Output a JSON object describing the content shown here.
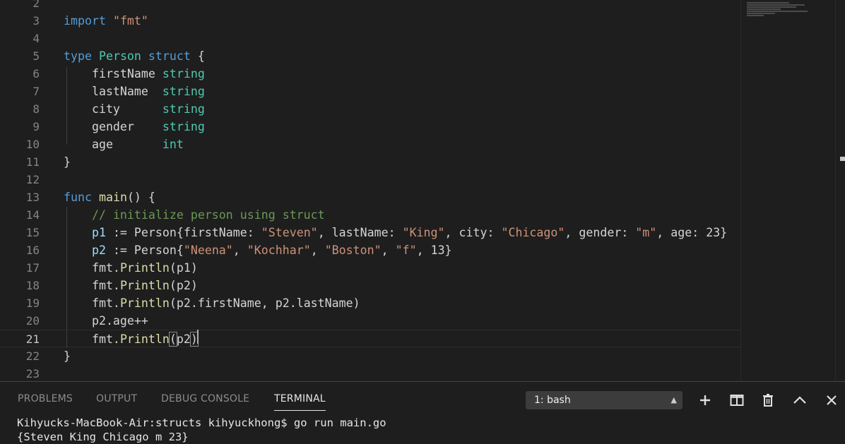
{
  "editor": {
    "lines": [
      {
        "num": "2",
        "tokens": []
      },
      {
        "num": "3",
        "tokens": [
          [
            "kw",
            "import"
          ],
          [
            "plain",
            " "
          ],
          [
            "str",
            "\"fmt\""
          ]
        ]
      },
      {
        "num": "4",
        "tokens": []
      },
      {
        "num": "5",
        "tokens": [
          [
            "kw",
            "type"
          ],
          [
            "plain",
            " "
          ],
          [
            "type",
            "Person"
          ],
          [
            "plain",
            " "
          ],
          [
            "kw",
            "struct"
          ],
          [
            "plain",
            " {"
          ]
        ]
      },
      {
        "num": "6",
        "tokens": [
          [
            "plain",
            "    firstName "
          ],
          [
            "type",
            "string"
          ]
        ]
      },
      {
        "num": "7",
        "tokens": [
          [
            "plain",
            "    lastName  "
          ],
          [
            "type",
            "string"
          ]
        ]
      },
      {
        "num": "8",
        "tokens": [
          [
            "plain",
            "    city      "
          ],
          [
            "type",
            "string"
          ]
        ]
      },
      {
        "num": "9",
        "tokens": [
          [
            "plain",
            "    gender    "
          ],
          [
            "type",
            "string"
          ]
        ]
      },
      {
        "num": "10",
        "tokens": [
          [
            "plain",
            "    age       "
          ],
          [
            "type",
            "int"
          ]
        ]
      },
      {
        "num": "11",
        "tokens": [
          [
            "plain",
            "}"
          ]
        ]
      },
      {
        "num": "12",
        "tokens": []
      },
      {
        "num": "13",
        "tokens": [
          [
            "kw",
            "func"
          ],
          [
            "plain",
            " "
          ],
          [
            "fn",
            "main"
          ],
          [
            "plain",
            "() {"
          ]
        ]
      },
      {
        "num": "14",
        "tokens": [
          [
            "plain",
            "    "
          ],
          [
            "com",
            "// initialize person using struct"
          ]
        ]
      },
      {
        "num": "15",
        "tokens": [
          [
            "plain",
            "    "
          ],
          [
            "var",
            "p1"
          ],
          [
            "plain",
            " := Person{firstName: "
          ],
          [
            "str",
            "\"Steven\""
          ],
          [
            "plain",
            ", lastName: "
          ],
          [
            "str",
            "\"King\""
          ],
          [
            "plain",
            ", city: "
          ],
          [
            "str",
            "\"Chicago\""
          ],
          [
            "plain",
            ", gender: "
          ],
          [
            "str",
            "\"m\""
          ],
          [
            "plain",
            ", age: 23}"
          ]
        ]
      },
      {
        "num": "16",
        "tokens": [
          [
            "plain",
            "    "
          ],
          [
            "var",
            "p2"
          ],
          [
            "plain",
            " := Person{"
          ],
          [
            "str",
            "\"Neena\""
          ],
          [
            "plain",
            ", "
          ],
          [
            "str",
            "\"Kochhar\""
          ],
          [
            "plain",
            ", "
          ],
          [
            "str",
            "\"Boston\""
          ],
          [
            "plain",
            ", "
          ],
          [
            "str",
            "\"f\""
          ],
          [
            "plain",
            ", 13}"
          ]
        ]
      },
      {
        "num": "17",
        "tokens": [
          [
            "plain",
            "    fmt."
          ],
          [
            "fn",
            "Println"
          ],
          [
            "plain",
            "(p1)"
          ]
        ]
      },
      {
        "num": "18",
        "tokens": [
          [
            "plain",
            "    fmt."
          ],
          [
            "fn",
            "Println"
          ],
          [
            "plain",
            "(p2)"
          ]
        ]
      },
      {
        "num": "19",
        "tokens": [
          [
            "plain",
            "    fmt."
          ],
          [
            "fn",
            "Println"
          ],
          [
            "plain",
            "(p2.firstName, p2.lastName)"
          ]
        ]
      },
      {
        "num": "20",
        "tokens": [
          [
            "plain",
            "    p2.age++"
          ]
        ]
      },
      {
        "num": "21",
        "tokens": [
          [
            "plain",
            "    fmt."
          ],
          [
            "fn",
            "Println"
          ],
          [
            "bracket",
            "("
          ],
          [
            "plain",
            "p2"
          ],
          [
            "bracket",
            ")"
          ]
        ],
        "current": true
      },
      {
        "num": "22",
        "tokens": [
          [
            "plain",
            "}"
          ]
        ]
      },
      {
        "num": "23",
        "tokens": []
      }
    ]
  },
  "panel": {
    "tabs": [
      {
        "id": "problems",
        "label": "PROBLEMS"
      },
      {
        "id": "output",
        "label": "OUTPUT"
      },
      {
        "id": "debug-console",
        "label": "DEBUG CONSOLE"
      },
      {
        "id": "terminal",
        "label": "TERMINAL",
        "active": true
      }
    ],
    "terminal_select": "1: bash",
    "icons": [
      "plus-icon",
      "split-terminal-icon",
      "trash-icon",
      "chevron-up-icon",
      "close-icon"
    ]
  },
  "terminal": {
    "lines": [
      "Kihyucks-MacBook-Air:structs kihyuckhong$ go run main.go",
      "{Steven King Chicago m 23}"
    ]
  }
}
